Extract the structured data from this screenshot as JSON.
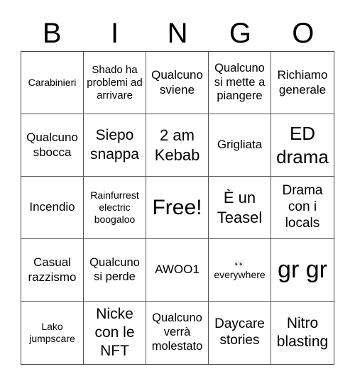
{
  "header": {
    "letters": [
      "B",
      "I",
      "N",
      "G",
      "O"
    ]
  },
  "cells": [
    {
      "text": "Carabinieri",
      "size": "s14"
    },
    {
      "text": "Shado ha problemi ad arrivare",
      "size": "s15"
    },
    {
      "text": "Qualcuno sviene",
      "size": "s17"
    },
    {
      "text": "Qualcuno si mette a piangere",
      "size": "s16"
    },
    {
      "text": "Richiamo generale",
      "size": "s17"
    },
    {
      "text": "Qualcuno sbocca",
      "size": "s17"
    },
    {
      "text": "Siepo snappa",
      "size": "s21"
    },
    {
      "text": "2 am Kebab",
      "size": "s22"
    },
    {
      "text": "Grigliata",
      "size": "s17"
    },
    {
      "text": "ED drama",
      "size": "s26"
    },
    {
      "text": "Incendio",
      "size": "s17"
    },
    {
      "text": "Rainfurrest electric boogaloo",
      "size": "s14"
    },
    {
      "text": "Free!",
      "size": "s30"
    },
    {
      "text": "È un Teasel",
      "size": "s22"
    },
    {
      "text": "Drama con i locals",
      "size": "s19"
    },
    {
      "text": "Casual razzismo",
      "size": "s17"
    },
    {
      "text": "Qualcuno si perde",
      "size": "s16"
    },
    {
      "text": "AWOO1",
      "size": "s17"
    },
    {
      "text": "everywhere",
      "emoji": "👀",
      "size": "s14"
    },
    {
      "text": "gr gr",
      "size": "s34"
    },
    {
      "text": "Lako jumpscare",
      "size": "s14"
    },
    {
      "text": "Nicke con le NFT",
      "size": "s21"
    },
    {
      "text": "Qualcuno verrà molestato",
      "size": "s16"
    },
    {
      "text": "Daycare stories",
      "size": "s19"
    },
    {
      "text": "Nitro blasting",
      "size": "s21"
    }
  ]
}
